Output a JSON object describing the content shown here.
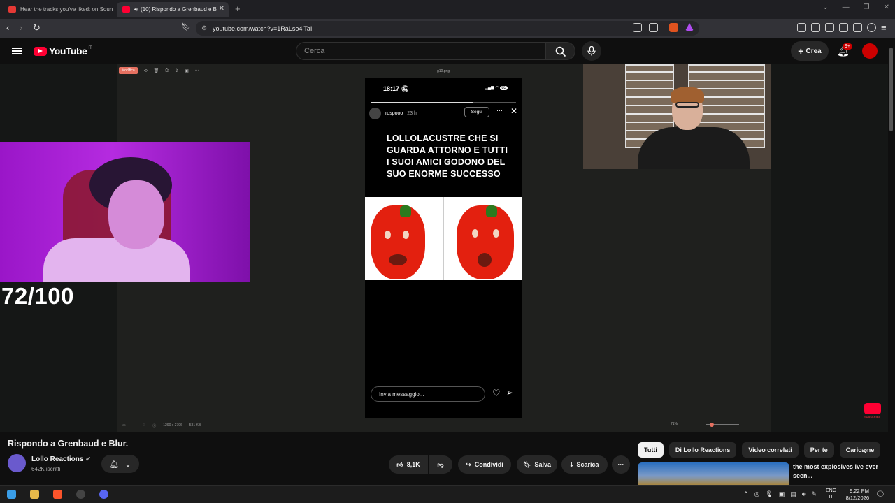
{
  "browser": {
    "tabs": [
      {
        "label": "Hear the tracks you've liked: on Soun"
      },
      {
        "label": "(10) Rispondo a Grenbaud e B"
      }
    ],
    "url": "youtube.com/watch?v=1RaLso4lTaI"
  },
  "youtube": {
    "logo": "YouTube",
    "country": "IT",
    "search_placeholder": "Cerca",
    "create_label": "Crea",
    "notification_count": "9+"
  },
  "video": {
    "viewer": {
      "filename": "g10.png",
      "modify_label": "Modifica",
      "dimensions": "1290 x 2796",
      "filesize": "531 KB",
      "zoom": "71%"
    },
    "story": {
      "time": "18:17",
      "battery": "83",
      "username": "rospooo",
      "age": "23 h",
      "follow_label": "Segui",
      "caption": "LOLLOLACUSTRE CHE SI GUARDA ATTORNO E TUTTI I SUOI AMICI GODONO DEL SUO ENORME SUCCESSO",
      "message_placeholder": "Invia messaggio...",
      "progress_fraction": 0.7
    },
    "score": "72/100",
    "subscribe_text": "SUBSCRIBE"
  },
  "watch": {
    "title": "Rispondo a Grenbaud e Blur.",
    "channel": "Lollo Reactions",
    "subscribers": "642K iscritti",
    "likes": "8,1K",
    "share_label": "Condividi",
    "save_label": "Salva",
    "download_label": "Scarica"
  },
  "chips": [
    "Tutti",
    "Di Lollo Reactions",
    "Video correlati",
    "Per te",
    "Caricame"
  ],
  "recommended": {
    "title": "the most explosives ive ever seen..."
  },
  "taskbar": {
    "lang_top": "ENG",
    "lang_bottom": "IT",
    "time": "9:22 PM",
    "date": "8/12/2026"
  }
}
